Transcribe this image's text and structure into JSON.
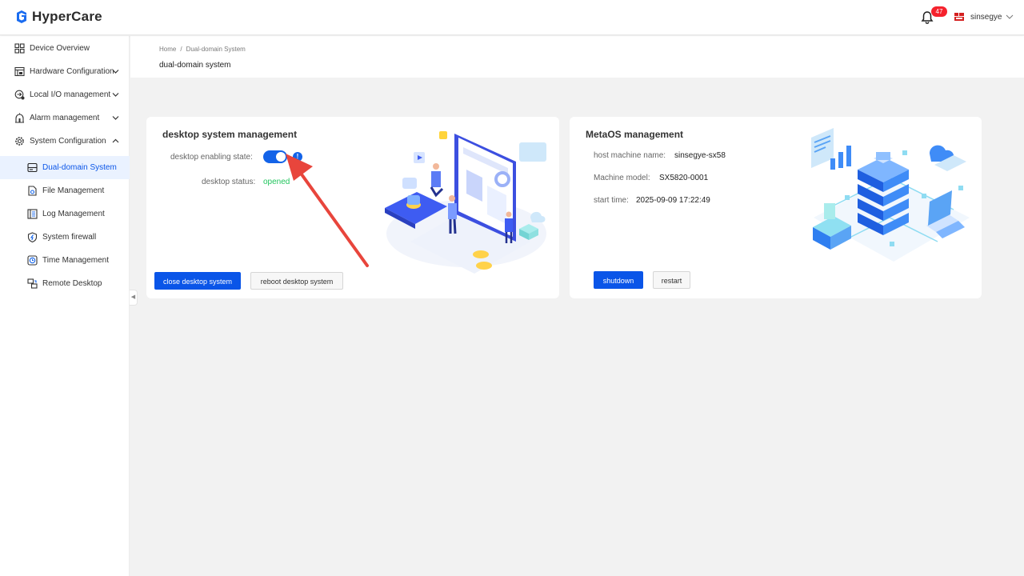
{
  "app": {
    "name": "HyperCare"
  },
  "header": {
    "notification_count": "47",
    "username": "sinsegye"
  },
  "sidebar": {
    "items": [
      {
        "label": "Device Overview",
        "icon": "grid-icon"
      },
      {
        "label": "Hardware Configuration",
        "icon": "hardware-icon"
      },
      {
        "label": "Local I/O management",
        "icon": "io-icon"
      },
      {
        "label": "Alarm management",
        "icon": "alarm-icon"
      },
      {
        "label": "System Configuration",
        "icon": "settings-icon"
      }
    ],
    "subitems": [
      {
        "label": "Dual-domain System",
        "icon": "dual-domain-icon",
        "active": true
      },
      {
        "label": "File Management",
        "icon": "file-icon"
      },
      {
        "label": "Log Management",
        "icon": "log-icon"
      },
      {
        "label": "System firewall",
        "icon": "shield-icon"
      },
      {
        "label": "Time Management",
        "icon": "clock-icon"
      },
      {
        "label": "Remote Desktop",
        "icon": "remote-desktop-icon"
      }
    ]
  },
  "breadcrumb": {
    "home": "Home",
    "sep": "/",
    "current": "Dual-domain System"
  },
  "page": {
    "title": "dual-domain system"
  },
  "desktop_card": {
    "title": "desktop system management",
    "enabling_label": "desktop enabling state:",
    "enabled": true,
    "status_label": "desktop status:",
    "status_value": "opened",
    "close_button": "close desktop system",
    "reboot_button": "reboot desktop system"
  },
  "metaos_card": {
    "title": "MetaOS management",
    "host_label": "host machine name:",
    "host_value": "sinsegye-sx58",
    "model_label": "Machine model:",
    "model_value": "SX5820-0001",
    "start_label": "start time:",
    "start_value": "2025-09-09 17:22:49",
    "shutdown_button": "shutdown",
    "restart_button": "restart"
  },
  "colors": {
    "primary": "#0a55e8",
    "status_green": "#22c55e",
    "badge_red": "#f5222d",
    "annotation_arrow": "#e8453c"
  }
}
